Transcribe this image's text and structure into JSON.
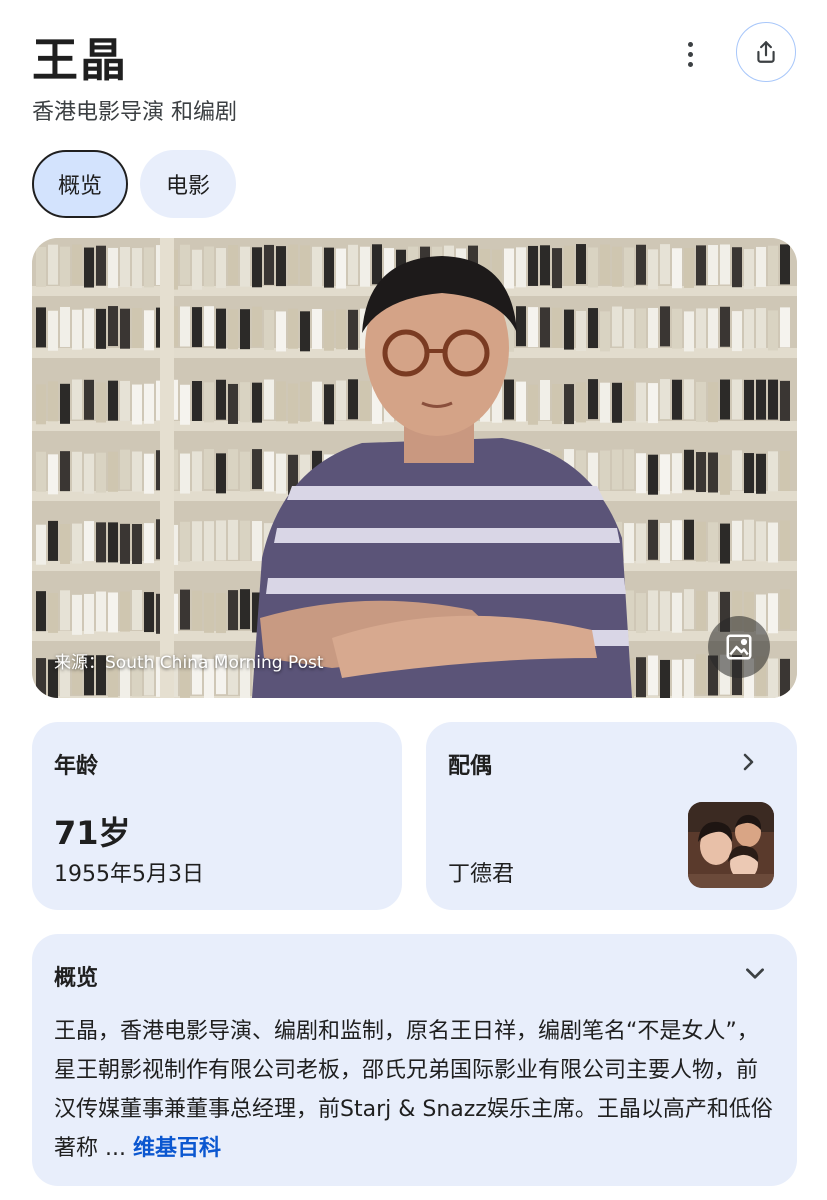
{
  "header": {
    "title": "王晶",
    "subtitle": "香港电影导演 和编剧"
  },
  "tabs": [
    {
      "label": "概览",
      "active": true
    },
    {
      "label": "电影",
      "active": false
    }
  ],
  "hero": {
    "caption": "来源：South China Morning Post"
  },
  "age_card": {
    "label": "年龄",
    "value": "71岁",
    "birthdate": "1955年5月3日"
  },
  "spouse_card": {
    "label": "配偶",
    "name": "丁德君"
  },
  "overview": {
    "label": "概览",
    "text": "王晶，香港电影导演、编剧和监制，原名王日祥，编剧笔名“不是女人”，星王朝影视制作有限公司老板，邵氏兄弟国际影业有限公司主要人物，前汉传媒董事兼董事总经理，前Starj & Snazz娱乐主席。王晶以高产和低俗著称 ...",
    "source_link": "维基百科"
  },
  "colors": {
    "card_bg": "#e8eefb",
    "active_tab_bg": "#d3e3fd",
    "link": "#0b57d0",
    "share_border": "#a8c7fa"
  },
  "icons": [
    "more-vert-icon",
    "share-icon",
    "image-icon",
    "chevron-right-icon",
    "chevron-down-icon"
  ]
}
